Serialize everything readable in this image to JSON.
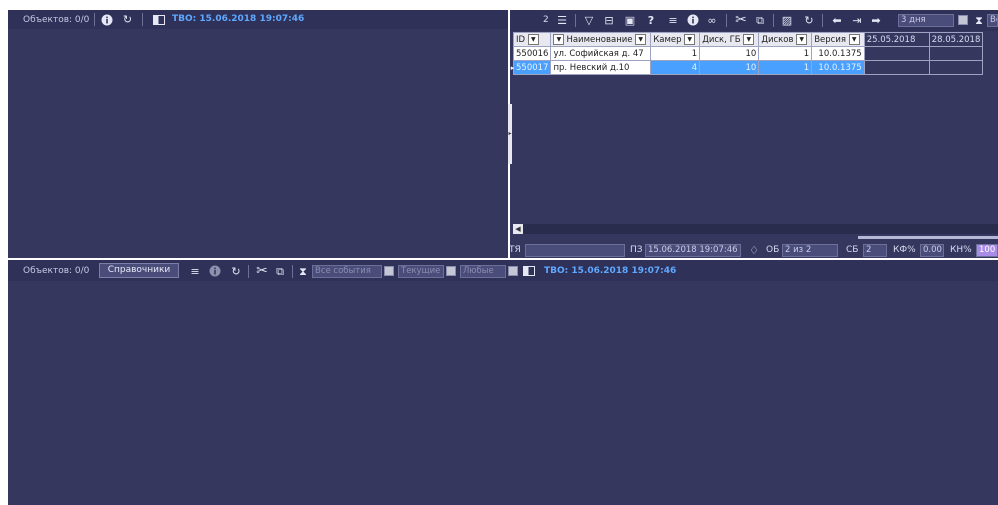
{
  "top_panel": {
    "objects_label": "Объектов: 0/0",
    "tvo_label": "ТВО: 15.06.2018 19:07:46"
  },
  "right_toolbar": {
    "count": "2",
    "period_value": "3 дня",
    "all_truncated": "Все"
  },
  "grid": {
    "columns": [
      "ID",
      "Наименование",
      "Камер",
      "Диск, ГБ",
      "Дисков",
      "Версия"
    ],
    "date_columns": [
      "25.05.2018",
      "28.05.2018"
    ],
    "rows": [
      {
        "id": "550016",
        "name": "ул. Софийская д. 47",
        "cams": "1",
        "disk": "10",
        "disks": "1",
        "version": "10.0.1375"
      },
      {
        "id": "550017",
        "name": "пр. Невский д.10",
        "cams": "4",
        "disk": "10",
        "disks": "1",
        "version": "10.0.1375"
      }
    ]
  },
  "status_row": {
    "ty_label": "ТЯ",
    "pz_label": "ПЗ",
    "pz_value": "15.06.2018 19:07:46",
    "ob_label": "ОБ",
    "ob_value": "2 из 2",
    "sb_label": "СБ",
    "sb_value": "2",
    "kf_label": "КФ%",
    "kf_value": "0.00",
    "kn_label": "КН%",
    "kn_value": "100"
  },
  "bottom_toolbar": {
    "objects_label": "Объектов: 0/0",
    "directories_button": "Справочники",
    "all_events": "Все события",
    "current": "Текущие",
    "any": "Любые",
    "tvo_label": "ТВО: 15.06.2018 19:07:46"
  },
  "colors": {
    "panel_bg": "#35375f",
    "toolbar_bg": "#2f3158",
    "accent_blue": "#5fa8ff",
    "selection": "#4aa0ff"
  }
}
